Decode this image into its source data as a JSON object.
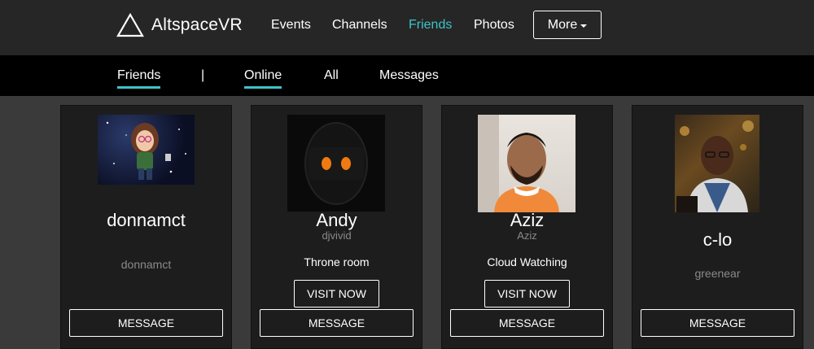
{
  "brand": {
    "name": "AltspaceVR"
  },
  "nav": {
    "events": "Events",
    "channels": "Channels",
    "friends": "Friends",
    "photos": "Photos",
    "more": "More"
  },
  "subnav": {
    "friends": "Friends",
    "separator": "|",
    "online": "Online",
    "all": "All",
    "messages": "Messages"
  },
  "colors": {
    "accent": "#3fc3c9",
    "topbar": "#262626",
    "subbar": "#000000",
    "card": "#1d1d1d",
    "page": "#3a3a3a"
  },
  "friends": [
    {
      "name": "donnamct",
      "handle": "donnamct",
      "room": "",
      "visit_label": "",
      "message_label": "MESSAGE",
      "avatar": "cartoon-avatar-space"
    },
    {
      "name": "Andy",
      "handle": "djvivid",
      "room": "Throne room",
      "visit_label": "VISIT NOW",
      "message_label": "MESSAGE",
      "avatar": "robot-avatar"
    },
    {
      "name": "Aziz",
      "handle": "Aziz",
      "room": "Cloud Watching",
      "visit_label": "VISIT NOW",
      "message_label": "MESSAGE",
      "avatar": "photo-avatar"
    },
    {
      "name": "c-lo",
      "handle": "greenear",
      "room": "",
      "visit_label": "",
      "message_label": "MESSAGE",
      "avatar": "photo-avatar"
    }
  ]
}
